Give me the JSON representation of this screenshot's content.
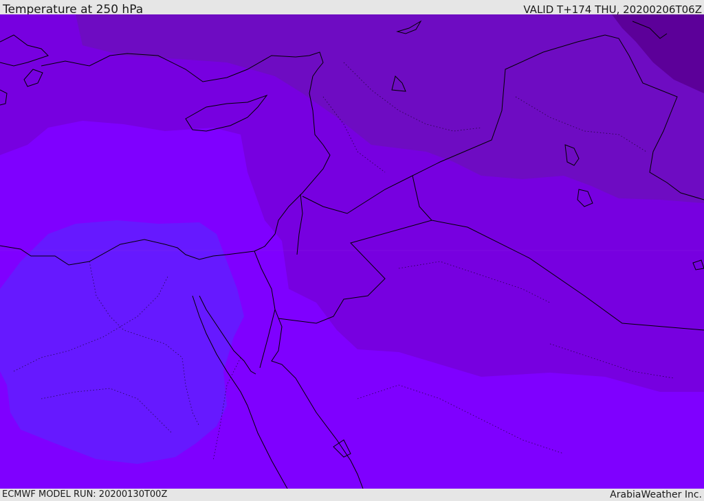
{
  "header": {
    "title": "Temperature at 250 hPa",
    "valid_time": "VALID T+174 THU, 20200206T06Z"
  },
  "footer": {
    "model_run": "ECMWF MODEL RUN: 20200130T00Z",
    "credit": "ArabiaWeather Inc."
  },
  "colors": {
    "base_violet": "#7f00ff",
    "mid_violet": "#7700e0",
    "dark_violet": "#6e0cc2",
    "darkest_violet": "#5c0099",
    "blue_violet": "#6619ff",
    "coastline": "#000000",
    "bar_background": "#e6e6e6"
  }
}
